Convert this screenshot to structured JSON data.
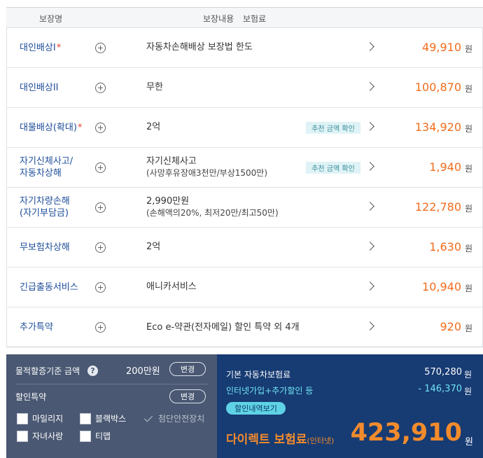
{
  "header": {
    "col_coverage": "보장명",
    "col_content": "보장내용",
    "col_premium": "보험료"
  },
  "rows": [
    {
      "name_lines": [
        "대인배상I"
      ],
      "required": "*",
      "content": "자동차손해배상 보장법 한도",
      "sub": "",
      "badge": "",
      "premium": "49,910",
      "unit": "원"
    },
    {
      "name_lines": [
        "대인배상II"
      ],
      "required": "",
      "content": "무한",
      "sub": "",
      "badge": "",
      "premium": "100,870",
      "unit": "원"
    },
    {
      "name_lines": [
        "대물배상(확대)"
      ],
      "required": "*",
      "content": "2억",
      "sub": "",
      "badge": "추천 금액 확인",
      "premium": "134,920",
      "unit": "원"
    },
    {
      "name_lines": [
        "자기신체사고/",
        "자동차상해"
      ],
      "required": "",
      "content": "자기신체사고",
      "sub": "(사망후유장애3천만/부상1500만)",
      "badge": "추천 금액 확인",
      "premium": "1,940",
      "unit": "원"
    },
    {
      "name_lines": [
        "자기차량손해",
        "(자기부담금)"
      ],
      "required": "",
      "content": "2,990만원",
      "sub": "(손해액의20%, 최저20만/최고50만)",
      "badge": "",
      "premium": "122,780",
      "unit": "원"
    },
    {
      "name_lines": [
        "무보험차상해"
      ],
      "required": "",
      "content": "2억",
      "sub": "",
      "badge": "",
      "premium": "1,630",
      "unit": "원"
    },
    {
      "name_lines": [
        "긴급출동서비스"
      ],
      "required": "",
      "content": "애니카서비스",
      "sub": "",
      "badge": "",
      "premium": "10,940",
      "unit": "원"
    },
    {
      "name_lines": [
        "추가특약"
      ],
      "required": "",
      "content": "Eco e-약관(전자메일) 할인 특약 외 4개",
      "sub": "",
      "badge": "",
      "premium": "920",
      "unit": "원"
    }
  ],
  "panel_left": {
    "property_label": "물적할증기준 금액",
    "help_icon": "?",
    "property_value": "200만원",
    "change_label": "변경",
    "discount_label": "할인특약",
    "options": [
      {
        "label": "마일리지",
        "checked": false,
        "disabled": false
      },
      {
        "label": "블랙박스",
        "checked": false,
        "disabled": false
      },
      {
        "label": "첨단안전장치",
        "checked": true,
        "disabled": true
      },
      {
        "label": "자녀사랑",
        "checked": false,
        "disabled": false
      },
      {
        "label": "티맵",
        "checked": false,
        "disabled": false
      }
    ]
  },
  "panel_right": {
    "base_label": "기본 자동차보험료",
    "base_amount": "570,280",
    "discount_label": "인터넷가입+추가할인 등",
    "discount_amount": "- 146,370",
    "won": "원",
    "detail_button": "할인내역보기",
    "final_label": "다이렉트 보험료",
    "final_label_sub": "(인터넷)",
    "final_amount": "423,910"
  },
  "colors": {
    "premium": "#f26c1d",
    "final": "#f28b2c",
    "discount_text": "#6fe3f2",
    "left_panel": "#4a5873",
    "right_panel": "#173b73"
  }
}
